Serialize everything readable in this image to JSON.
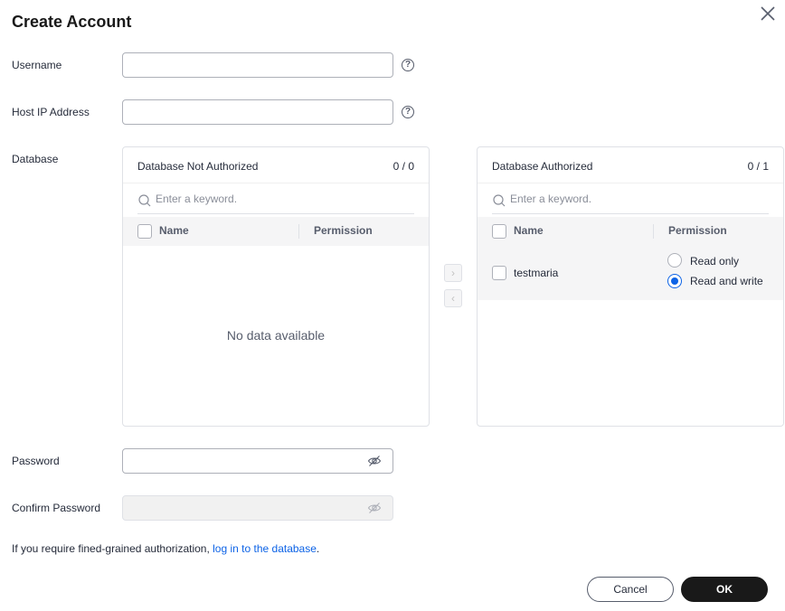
{
  "dialog": {
    "title": "Create Account"
  },
  "fields": {
    "username": {
      "label": "Username",
      "value": "",
      "help": "?"
    },
    "host_ip": {
      "label": "Host IP Address",
      "value": "",
      "help": "?"
    },
    "database_label": "Database",
    "password": {
      "label": "Password",
      "value": ""
    },
    "confirm_password": {
      "label": "Confirm Password",
      "value": ""
    }
  },
  "left_panel": {
    "title": "Database Not Authorized",
    "count": "0 / 0",
    "search_placeholder": "Enter a keyword.",
    "col_name": "Name",
    "col_permission": "Permission",
    "empty_text": "No data available"
  },
  "right_panel": {
    "title": "Database Authorized",
    "count": "0 / 1",
    "search_placeholder": "Enter a keyword.",
    "col_name": "Name",
    "col_permission": "Permission",
    "rows": [
      {
        "name": "testmaria",
        "options": [
          "Read only",
          "Read and write"
        ],
        "selected": "Read and write"
      }
    ]
  },
  "transfer": {
    "move_right": "›",
    "move_left": "‹"
  },
  "footer": {
    "note_prefix": "If you require fined-grained authorization, ",
    "note_link": "log in to the database",
    "note_suffix": ".",
    "cancel_label": "Cancel",
    "ok_label": "OK"
  },
  "colors": {
    "accent": "#0d63e6",
    "primary_button": "#191919"
  }
}
